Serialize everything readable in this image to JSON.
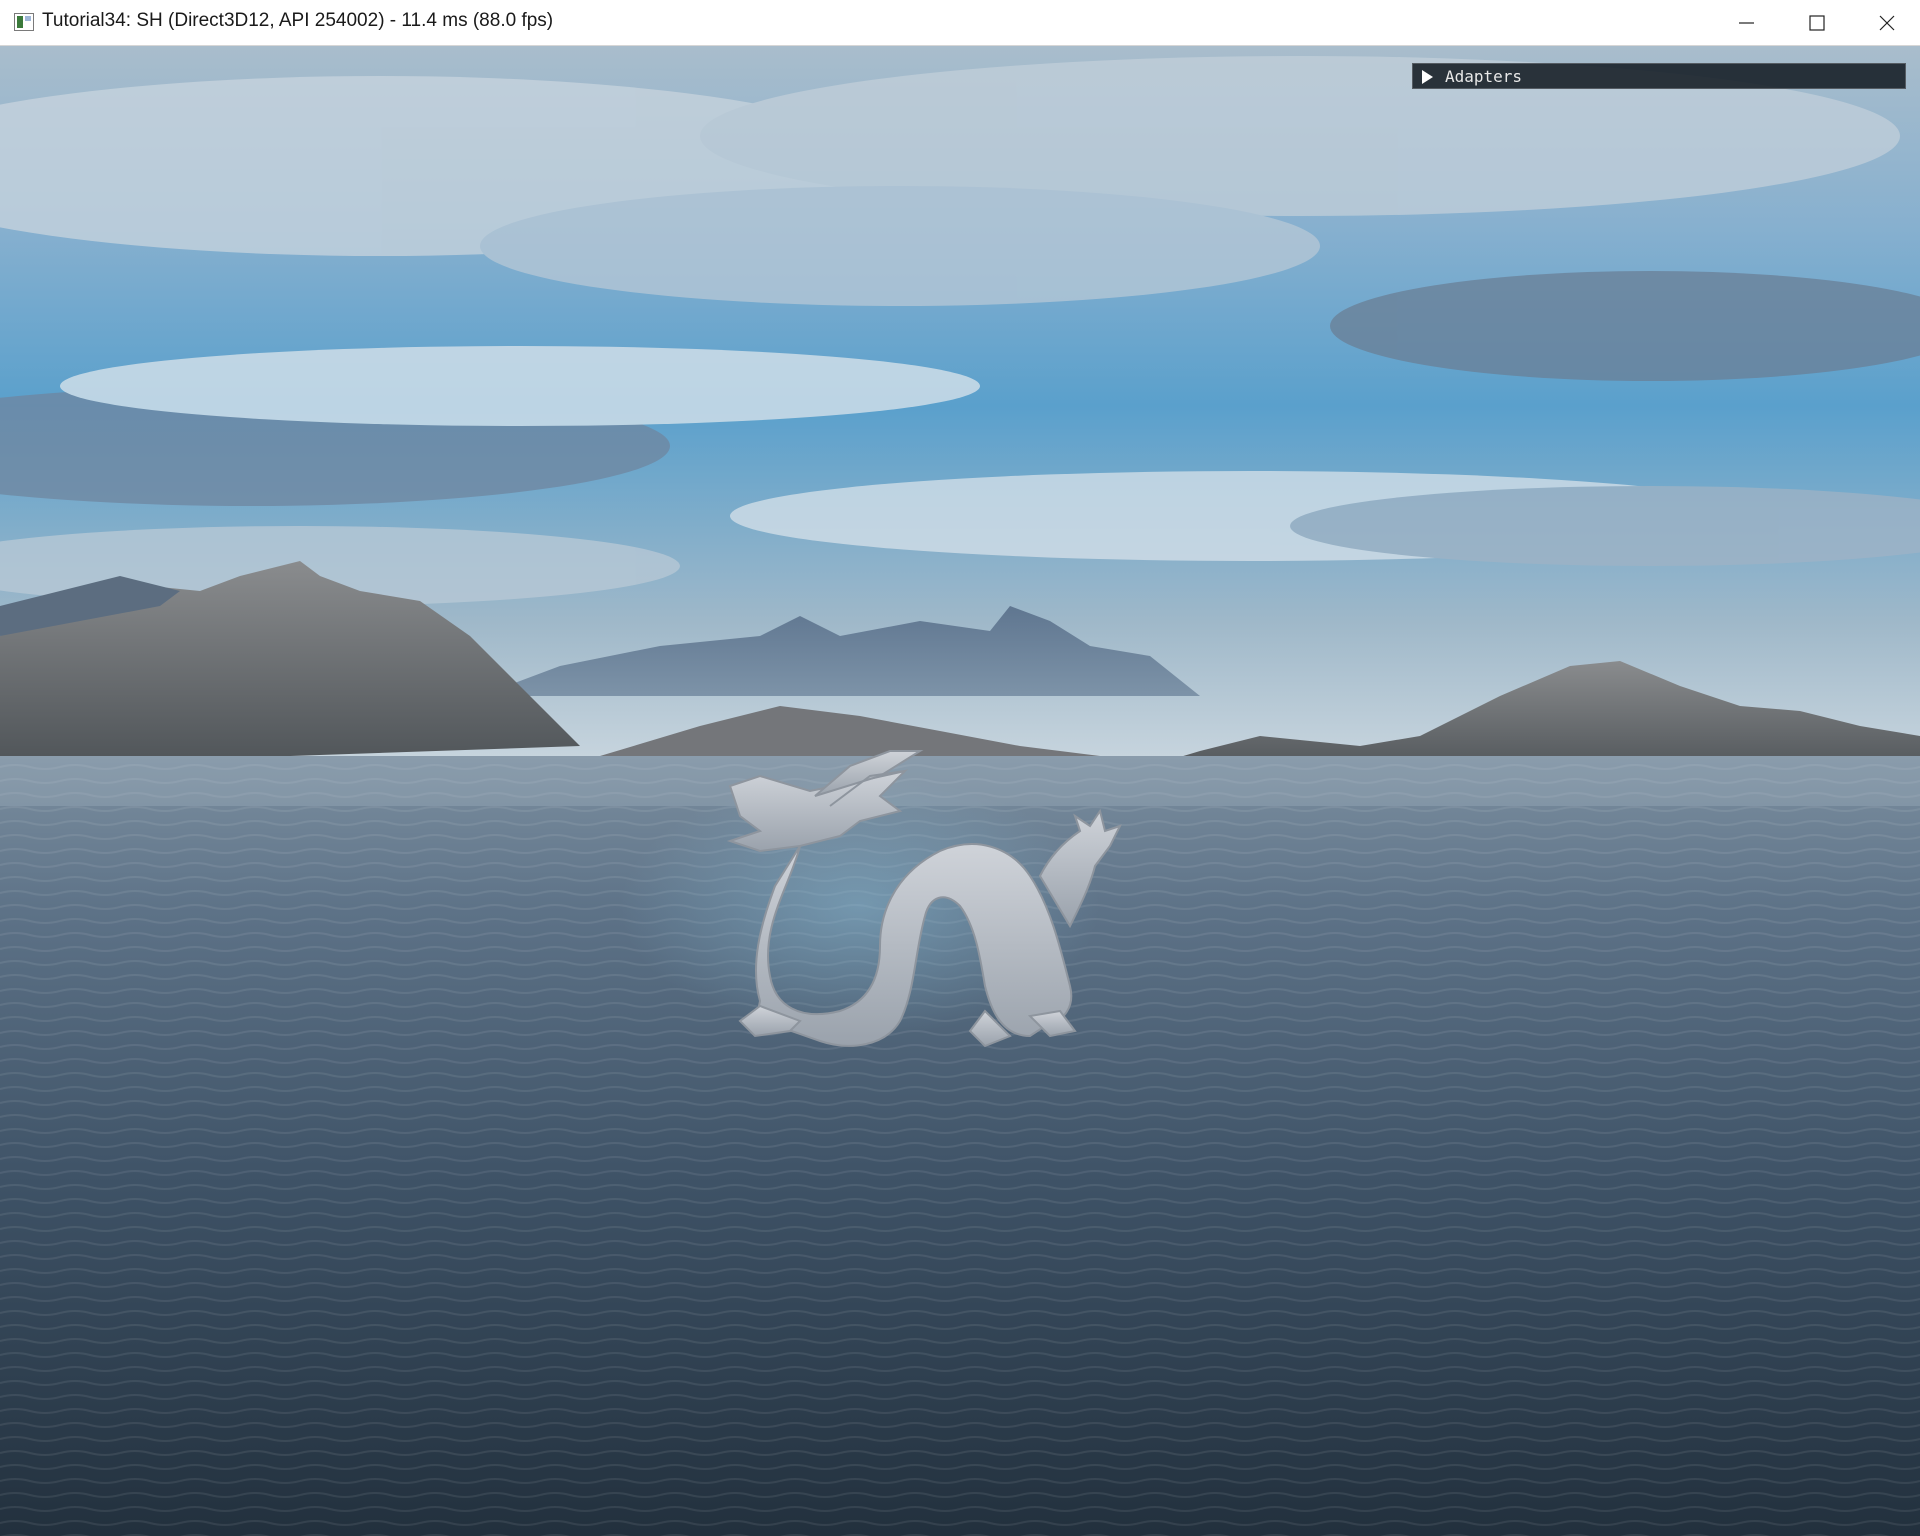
{
  "window": {
    "title": "Tutorial34: SH (Direct3D12, API 254002) - 11.4 ms (88.0 fps)",
    "app_icon": "window-app-icon",
    "controls": [
      {
        "name": "minimize",
        "icon": "minimize-icon"
      },
      {
        "name": "maximize",
        "icon": "maximize-icon"
      },
      {
        "name": "close",
        "icon": "close-icon"
      }
    ]
  },
  "overlay": {
    "adapters_label": "Adapters",
    "adapters_collapsed": true,
    "icon": "triangle-right-icon"
  },
  "scene": {
    "description_hidden": true,
    "colors": {
      "sky_top": "#9ab2c6",
      "sky_blue": "#5aa0cc",
      "water_near": "#2b3a48",
      "water_far": "#6b8094",
      "mountain": "#6e7276",
      "dragon": "#b9bec6"
    }
  }
}
